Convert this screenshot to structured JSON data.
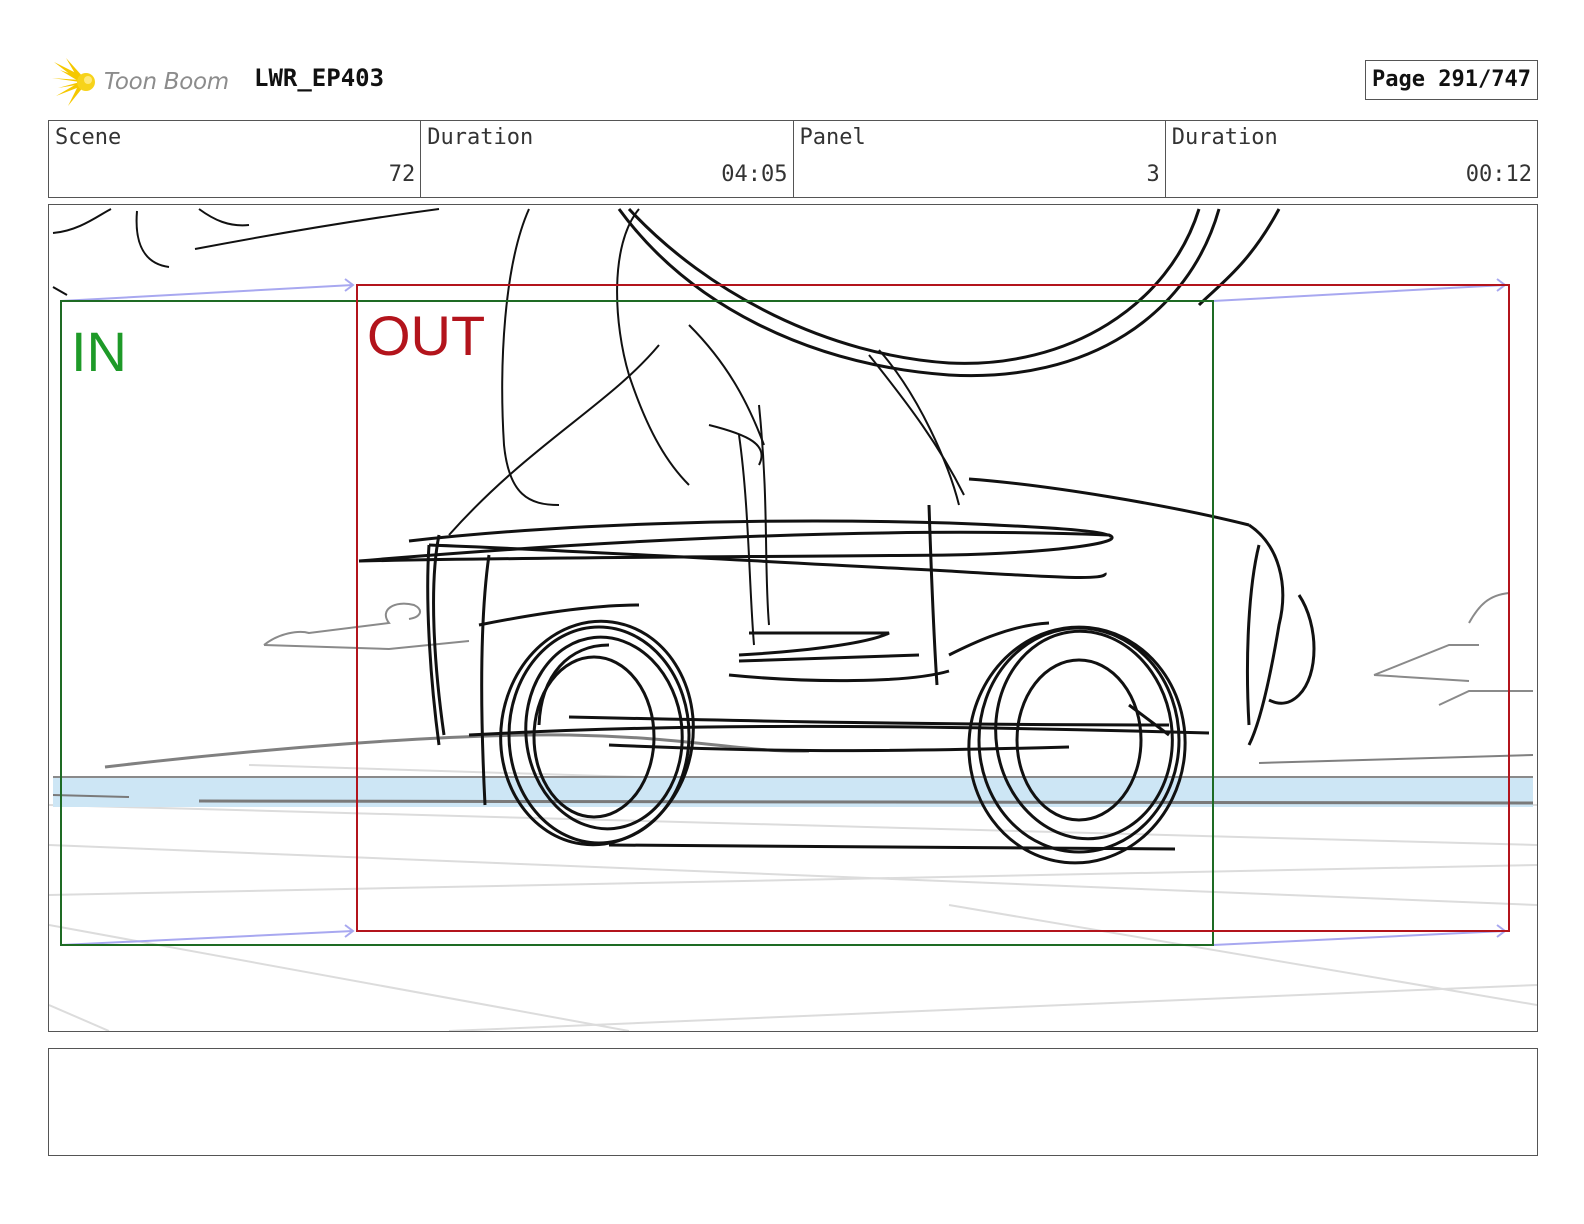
{
  "header": {
    "brand_name": "Toon Boom",
    "project_title": "LWR_EP403",
    "page_label": "Page 291/747"
  },
  "info": {
    "scene_label": "Scene",
    "scene_value": "72",
    "scene_duration_label": "Duration",
    "scene_duration_value": "04:05",
    "panel_label": "Panel",
    "panel_value": "3",
    "panel_duration_label": "Duration",
    "panel_duration_value": "00:12"
  },
  "panel_frames": {
    "in_label": "IN",
    "out_label": "OUT",
    "in_color": "#1e9a28",
    "out_color": "#b3141c"
  },
  "colors": {
    "logo_accent": "#f5c800",
    "sketch_line": "#111111",
    "water": "#cde6f5",
    "motion_arrow": "#a8a8f0"
  },
  "notes": {
    "text": ""
  }
}
